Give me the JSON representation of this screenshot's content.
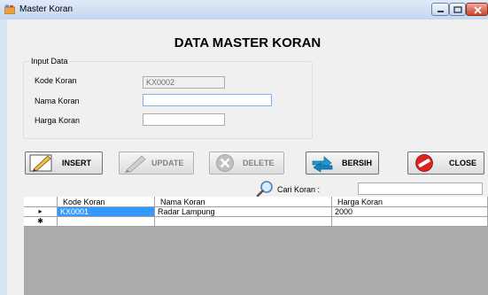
{
  "window": {
    "title": "Master Koran"
  },
  "form": {
    "heading": "DATA MASTER KORAN",
    "group_title": "Input Data",
    "kode_label": "Kode Koran",
    "kode_value": "KX0002",
    "nama_label": "Nama Koran",
    "nama_value": "",
    "harga_label": "Harga Koran",
    "harga_value": ""
  },
  "buttons": {
    "insert": "INSERT",
    "update": "UPDATE",
    "delete": "DELETE",
    "bersih": "BERSIH",
    "close": "CLOSE"
  },
  "search": {
    "label": "Cari Koran :",
    "value": ""
  },
  "grid": {
    "columns": [
      "Kode Koran",
      "Nama Koran",
      "Harga Koran"
    ],
    "rows": [
      {
        "indicator": "▸",
        "cells": [
          "KX0001",
          "Radar Lampung",
          "2000"
        ]
      },
      {
        "indicator": "✱",
        "cells": [
          "",
          "",
          ""
        ]
      }
    ]
  },
  "colors": {
    "selection": "#3399ff",
    "client_bg": "#f0f0f0",
    "grid_bg": "#ababab"
  }
}
